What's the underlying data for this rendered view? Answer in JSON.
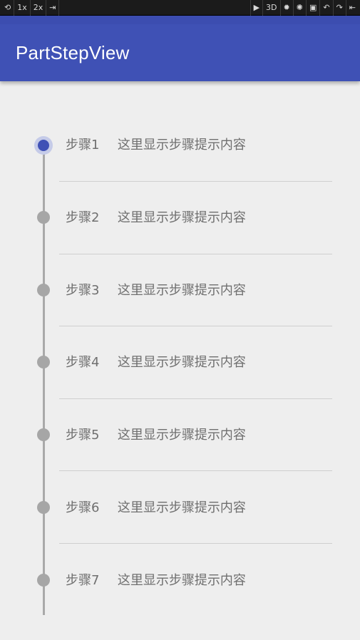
{
  "toolbar": {
    "scale_1x": "1x",
    "scale_2x": "2x",
    "mode_3d": "3D"
  },
  "app_bar": {
    "title": "PartStepView",
    "background_color": "#3f51b5"
  },
  "steps": [
    {
      "label": "步骤1",
      "hint": "这里显示步骤提示内容",
      "state": "active"
    },
    {
      "label": "步骤2",
      "hint": "这里显示步骤提示内容",
      "state": "pending"
    },
    {
      "label": "步骤3",
      "hint": "这里显示步骤提示内容",
      "state": "pending"
    },
    {
      "label": "步骤4",
      "hint": "这里显示步骤提示内容",
      "state": "pending"
    },
    {
      "label": "步骤5",
      "hint": "这里显示步骤提示内容",
      "state": "pending"
    },
    {
      "label": "步骤6",
      "hint": "这里显示步骤提示内容",
      "state": "pending"
    },
    {
      "label": "步骤7",
      "hint": "这里显示步骤提示内容",
      "state": "pending"
    }
  ],
  "colors": {
    "accent": "#3f51b5",
    "inactive_dot": "#a6a6a6",
    "line": "#a9a9a9",
    "text": "#6f6f6f"
  }
}
